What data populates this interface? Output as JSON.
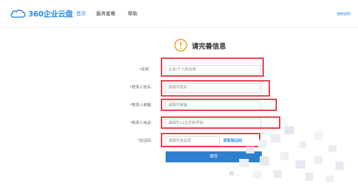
{
  "header": {
    "brand": "360企业云盘",
    "nav": [
      {
        "label": "首页",
        "active": true
      },
      {
        "label": "服务套餐",
        "active": false
      },
      {
        "label": "帮助",
        "active": false
      }
    ],
    "top_right_link": "使用说明"
  },
  "heading": {
    "title": "请完善信息",
    "icon": "warning-icon"
  },
  "form": {
    "company": {
      "label": "名称：",
      "required": "*",
      "placeholder": "企业/个人的名称"
    },
    "contact_name": {
      "label": "联系人姓名：",
      "required": "*",
      "placeholder": "请填写姓名"
    },
    "email": {
      "label": "联系人邮箱：",
      "required": "*",
      "placeholder": "请填写邮箱"
    },
    "phone": {
      "label": "联系人电话：",
      "required": "*",
      "placeholder": "请填写11位手机号码"
    },
    "code": {
      "label": "验证码：",
      "required": "*",
      "placeholder": "请填写验证码",
      "button": "获取验证码"
    },
    "save_label": "保存"
  },
  "watermark": "W..."
}
